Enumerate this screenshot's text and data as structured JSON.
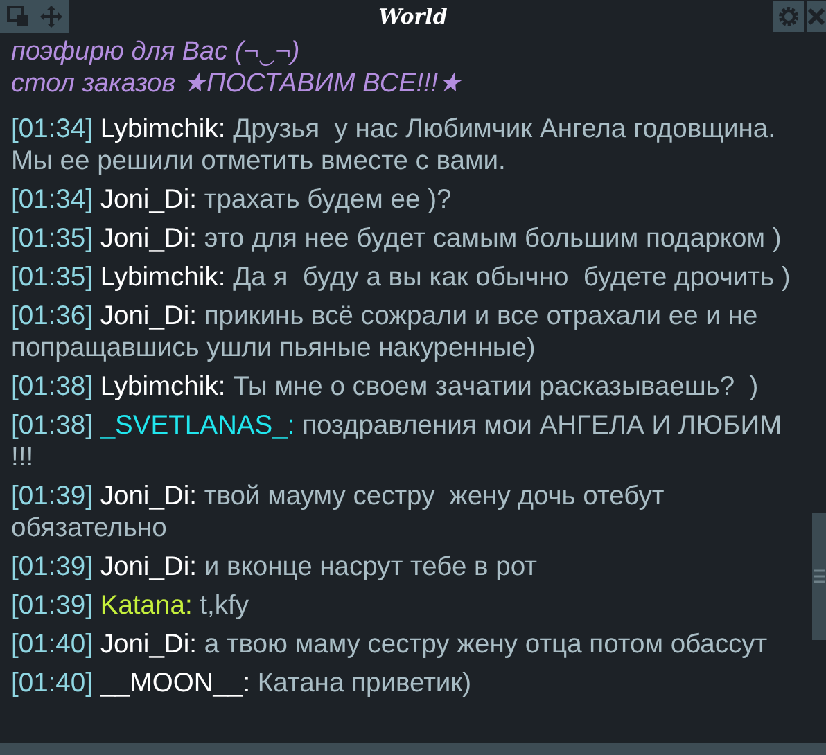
{
  "window": {
    "title": "World"
  },
  "notice_lines": [
    "поэфирю для Вас (¬‿¬)",
    "стол заказов ★ПОСТАВИМ ВСЕ!!!★"
  ],
  "messages": [
    {
      "time": "[01:34]",
      "name": "Lybimchik:",
      "color": "#ffffff",
      "text": "Друзья  у нас Любимчик Ангела годовщина. Мы ее решили отметить вместе с вами."
    },
    {
      "time": "[01:34]",
      "name": "Joni_Di:",
      "color": "#ffffff",
      "text": "трахать будем ее )?"
    },
    {
      "time": "[01:35]",
      "name": "Joni_Di:",
      "color": "#ffffff",
      "text": "это для нее будет самым большим подарком )"
    },
    {
      "time": "[01:35]",
      "name": "Lybimchik:",
      "color": "#ffffff",
      "text": "Да я  буду а вы как обычно  будете дрочить )"
    },
    {
      "time": "[01:36]",
      "name": "Joni_Di:",
      "color": "#ffffff",
      "text": "прикинь всё сожрали и все отрахали ее и не попращавшись ушли пьяные накуренные)"
    },
    {
      "time": "[01:38]",
      "name": "Lybimchik:",
      "color": "#ffffff",
      "text": "Ты мне о своем зачатии расказываешь?  )"
    },
    {
      "time": "[01:38]",
      "name": "_SVETLANAS_:",
      "color": "#21e6ee",
      "text": "поздравления мои АНГЕЛА И ЛЮБИМ !!!"
    },
    {
      "time": "[01:39]",
      "name": "Joni_Di:",
      "color": "#ffffff",
      "text": "твой мауму сестру  жену дочь отебут обязательно"
    },
    {
      "time": "[01:39]",
      "name": "Joni_Di:",
      "color": "#ffffff",
      "text": "и вконце насрут тебе в рот"
    },
    {
      "time": "[01:39]",
      "name": "Katana:",
      "color": "#c6f03c",
      "text": "t,kfy"
    },
    {
      "time": "[01:40]",
      "name": "Joni_Di:",
      "color": "#ffffff",
      "text": "а твою маму сестру жену отца потом обассут"
    },
    {
      "time": "[01:40]",
      "name": "__MOON__:",
      "color": "#ffffff",
      "text": "Катана приветик)"
    }
  ]
}
